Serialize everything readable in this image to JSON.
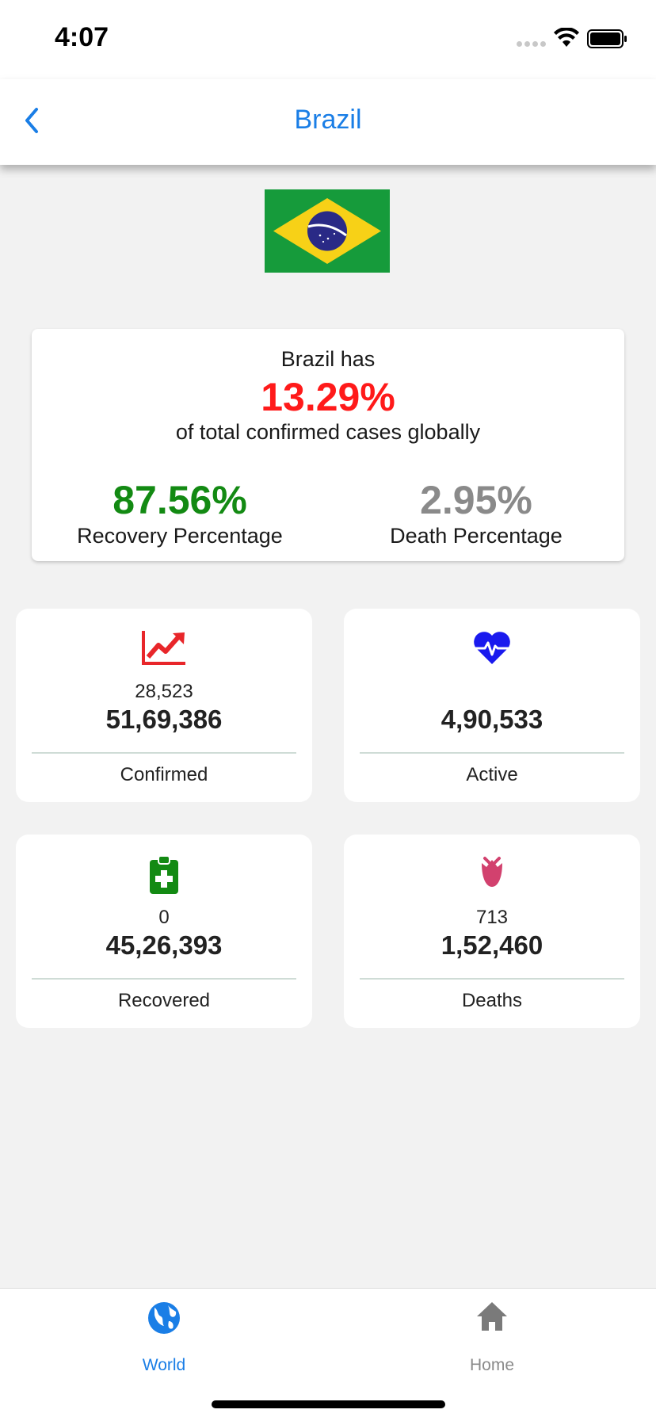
{
  "status_bar": {
    "time": "4:07"
  },
  "nav": {
    "title": "Brazil",
    "back_icon": "chevron-left-icon"
  },
  "summary": {
    "intro": "Brazil has",
    "percent_of_global": "13.29%",
    "suffix": "of total confirmed cases globally",
    "recovery_value": "87.56%",
    "recovery_label": "Recovery Percentage",
    "death_value": "2.95%",
    "death_label": "Death Percentage"
  },
  "tiles": {
    "confirmed": {
      "icon": "trending-up-icon",
      "delta": "28,523",
      "total": "51,69,386",
      "label": "Confirmed"
    },
    "active": {
      "icon": "heartbeat-icon",
      "delta": "",
      "total": "4,90,533",
      "label": "Active"
    },
    "recovered": {
      "icon": "clipboard-medical-icon",
      "delta": "0",
      "total": "45,26,393",
      "label": "Recovered"
    },
    "deaths": {
      "icon": "rose-icon",
      "delta": "713",
      "total": "1,52,460",
      "label": "Deaths"
    }
  },
  "tab_bar": {
    "world_label": "World",
    "home_label": "Home",
    "active_tab": "World"
  },
  "colors": {
    "accent": "#1a7ee6",
    "percent_red": "#ff1a1a",
    "recovery_green": "#138a13",
    "death_gray": "#8a8a8a",
    "confirmed_icon": "#e8262a",
    "active_icon": "#1a1aee",
    "recovered_icon": "#138a13",
    "deaths_icon": "#d2416e"
  }
}
